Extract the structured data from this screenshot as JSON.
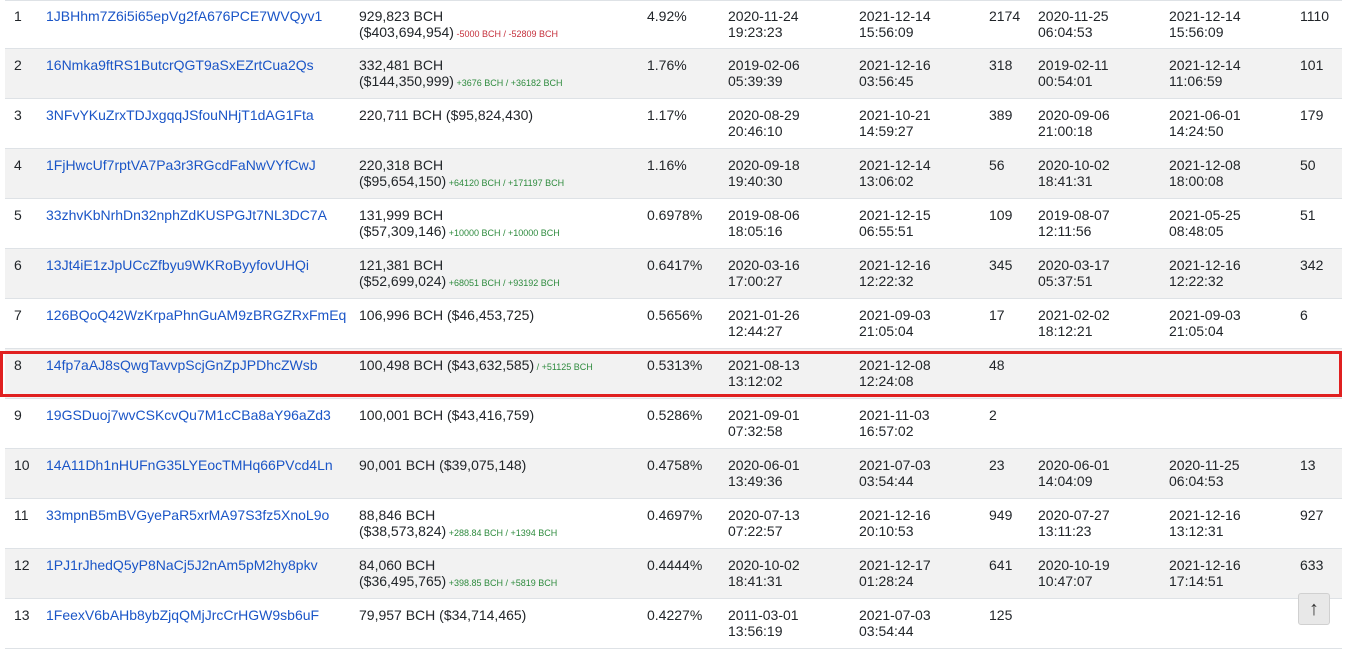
{
  "scroll_top_icon": "↑",
  "colors": {
    "link": "#1a55c7",
    "negative": "#c5303c",
    "positive": "#2e8b3e",
    "highlight": "#e02020"
  },
  "rows": [
    {
      "rank": "1",
      "address": "1JBHhm7Z6i5i65epVg2fA676PCE7WVQyv1",
      "balance_bch": "929,823 BCH",
      "balance_usd": "($403,694,954)",
      "change": " -5000 BCH / -52809 BCH",
      "change_sign": "neg",
      "pct": "4.92%",
      "first_in_date": "2020-11-24",
      "first_in_time": "19:23:23",
      "last_in_date": "2021-12-14",
      "last_in_time": "15:56:09",
      "ins": "2174",
      "first_out_date": "2020-11-25",
      "first_out_time": "06:04:53",
      "last_out_date": "2021-12-14",
      "last_out_time": "15:56:09",
      "outs": "1110"
    },
    {
      "rank": "2",
      "address": "16Nmka9ftRS1ButcrQGT9aSxEZrtCua2Qs",
      "balance_bch": "332,481 BCH",
      "balance_usd": "($144,350,999)",
      "change": " +3676 BCH / +36182 BCH",
      "change_sign": "pos",
      "pct": "1.76%",
      "first_in_date": "2019-02-06",
      "first_in_time": "05:39:39",
      "last_in_date": "2021-12-16",
      "last_in_time": "03:56:45",
      "ins": "318",
      "first_out_date": "2019-02-11",
      "first_out_time": "00:54:01",
      "last_out_date": "2021-12-14",
      "last_out_time": "11:06:59",
      "outs": "101"
    },
    {
      "rank": "3",
      "address": "3NFvYKuZrxTDJxgqqJSfouNHjT1dAG1Fta",
      "balance_bch": "220,711 BCH ($95,824,430)",
      "balance_usd": "",
      "change": "",
      "change_sign": "",
      "pct": "1.17%",
      "first_in_date": "2020-08-29",
      "first_in_time": "20:46:10",
      "last_in_date": "2021-10-21",
      "last_in_time": "14:59:27",
      "ins": "389",
      "first_out_date": "2020-09-06",
      "first_out_time": "21:00:18",
      "last_out_date": "2021-06-01",
      "last_out_time": "14:24:50",
      "outs": "179"
    },
    {
      "rank": "4",
      "address": "1FjHwcUf7rptVA7Pa3r3RGcdFaNwVYfCwJ",
      "balance_bch": "220,318 BCH",
      "balance_usd": "($95,654,150)",
      "change": " +64120 BCH / +171197 BCH",
      "change_sign": "pos",
      "pct": "1.16%",
      "first_in_date": "2020-09-18",
      "first_in_time": "19:40:30",
      "last_in_date": "2021-12-14",
      "last_in_time": "13:06:02",
      "ins": "56",
      "first_out_date": "2020-10-02",
      "first_out_time": "18:41:31",
      "last_out_date": "2021-12-08",
      "last_out_time": "18:00:08",
      "outs": "50"
    },
    {
      "rank": "5",
      "address": "33zhvKbNrhDn32nphZdKUSPGJt7NL3DC7A",
      "balance_bch": "131,999 BCH",
      "balance_usd": "($57,309,146)",
      "change": " +10000 BCH / +10000 BCH",
      "change_sign": "pos",
      "pct": "0.6978%",
      "first_in_date": "2019-08-06",
      "first_in_time": "18:05:16",
      "last_in_date": "2021-12-15",
      "last_in_time": "06:55:51",
      "ins": "109",
      "first_out_date": "2019-08-07",
      "first_out_time": "12:11:56",
      "last_out_date": "2021-05-25",
      "last_out_time": "08:48:05",
      "outs": "51"
    },
    {
      "rank": "6",
      "address": "13Jt4iE1zJpUCcZfbyu9WKRoByyfovUHQi",
      "balance_bch": "121,381 BCH",
      "balance_usd": "($52,699,024)",
      "change": " +68051 BCH / +93192 BCH",
      "change_sign": "pos",
      "pct": "0.6417%",
      "first_in_date": "2020-03-16",
      "first_in_time": "17:00:27",
      "last_in_date": "2021-12-16",
      "last_in_time": "12:22:32",
      "ins": "345",
      "first_out_date": "2020-03-17",
      "first_out_time": "05:37:51",
      "last_out_date": "2021-12-16",
      "last_out_time": "12:22:32",
      "outs": "342"
    },
    {
      "rank": "7",
      "address": "126BQoQ42WzKrpaPhnGuAM9zBRGZRxFmEq",
      "balance_bch": "106,996 BCH ($46,453,725)",
      "balance_usd": "",
      "change": "",
      "change_sign": "",
      "pct": "0.5656%",
      "first_in_date": "2021-01-26",
      "first_in_time": "12:44:27",
      "last_in_date": "2021-09-03",
      "last_in_time": "21:05:04",
      "ins": "17",
      "first_out_date": "2021-02-02",
      "first_out_time": "18:12:21",
      "last_out_date": "2021-09-03",
      "last_out_time": "21:05:04",
      "outs": "6"
    },
    {
      "rank": "8",
      "address": "14fp7aAJ8sQwgTavvpScjGnZpJPDhcZWsb",
      "balance_bch": "100,498 BCH ($43,632,585)",
      "balance_usd": "",
      "change": " / +51125 BCH",
      "change_sign": "pos",
      "pct": "0.5313%",
      "first_in_date": "2021-08-13",
      "first_in_time": "13:12:02",
      "last_in_date": "2021-12-08",
      "last_in_time": "12:24:08",
      "ins": "48",
      "first_out_date": "",
      "first_out_time": "",
      "last_out_date": "",
      "last_out_time": "",
      "outs": ""
    },
    {
      "rank": "9",
      "address": "19GSDuoj7wvCSKcvQu7M1cCBa8aY96aZd3",
      "balance_bch": "100,001 BCH ($43,416,759)",
      "balance_usd": "",
      "change": "",
      "change_sign": "",
      "pct": "0.5286%",
      "first_in_date": "2021-09-01",
      "first_in_time": "07:32:58",
      "last_in_date": "2021-11-03",
      "last_in_time": "16:57:02",
      "ins": "2",
      "first_out_date": "",
      "first_out_time": "",
      "last_out_date": "",
      "last_out_time": "",
      "outs": ""
    },
    {
      "rank": "10",
      "address": "14A11Dh1nHUFnG35LYEocTMHq66PVcd4Ln",
      "balance_bch": "90,001 BCH ($39,075,148)",
      "balance_usd": "",
      "change": "",
      "change_sign": "",
      "pct": "0.4758%",
      "first_in_date": "2020-06-01",
      "first_in_time": "13:49:36",
      "last_in_date": "2021-07-03",
      "last_in_time": "03:54:44",
      "ins": "23",
      "first_out_date": "2020-06-01",
      "first_out_time": "14:04:09",
      "last_out_date": "2020-11-25",
      "last_out_time": "06:04:53",
      "outs": "13"
    },
    {
      "rank": "11",
      "address": "33mpnB5mBVGyePaR5xrMA97S3fz5XnoL9o",
      "balance_bch": "88,846 BCH",
      "balance_usd": "($38,573,824)",
      "change": " +288.84 BCH / +1394 BCH",
      "change_sign": "pos",
      "pct": "0.4697%",
      "first_in_date": "2020-07-13",
      "first_in_time": "07:22:57",
      "last_in_date": "2021-12-16",
      "last_in_time": "20:10:53",
      "ins": "949",
      "first_out_date": "2020-07-27",
      "first_out_time": "13:11:23",
      "last_out_date": "2021-12-16",
      "last_out_time": "13:12:31",
      "outs": "927"
    },
    {
      "rank": "12",
      "address": "1PJ1rJhedQ5yP8NaCj5J2nAm5pM2hy8pkv",
      "balance_bch": "84,060 BCH",
      "balance_usd": "($36,495,765)",
      "change": " +398.85 BCH / +5819 BCH",
      "change_sign": "pos",
      "pct": "0.4444%",
      "first_in_date": "2020-10-02",
      "first_in_time": "18:41:31",
      "last_in_date": "2021-12-17",
      "last_in_time": "01:28:24",
      "ins": "641",
      "first_out_date": "2020-10-19",
      "first_out_time": "10:47:07",
      "last_out_date": "2021-12-16",
      "last_out_time": "17:14:51",
      "outs": "633"
    },
    {
      "rank": "13",
      "address": "1FeexV6bAHb8ybZjqQMjJrcCrHGW9sb6uF",
      "balance_bch": "79,957 BCH ($34,714,465)",
      "balance_usd": "",
      "change": "",
      "change_sign": "",
      "pct": "0.4227%",
      "first_in_date": "2011-03-01",
      "first_in_time": "13:56:19",
      "last_in_date": "2021-07-03",
      "last_in_time": "03:54:44",
      "ins": "125",
      "first_out_date": "",
      "first_out_time": "",
      "last_out_date": "",
      "last_out_time": "",
      "outs": ""
    }
  ]
}
